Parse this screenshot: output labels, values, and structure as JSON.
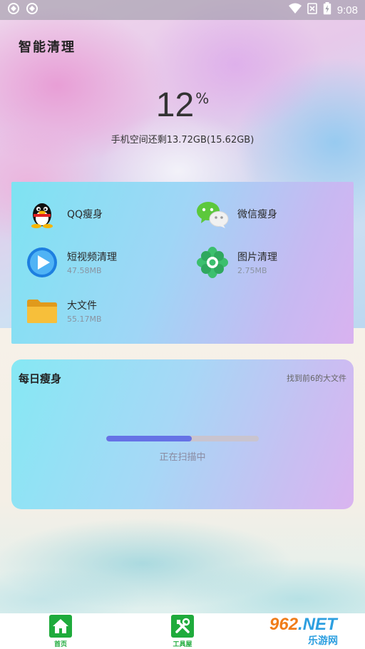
{
  "status_bar": {
    "time": "9:08",
    "left_icons": [
      "settings-shortcut-icon",
      "settings-shortcut-icon"
    ],
    "right_icons": [
      "wifi-icon",
      "no-sim-icon",
      "battery-icon"
    ]
  },
  "header": {
    "title": "智能清理",
    "percent_value": "12",
    "percent_sign": "%",
    "storage_text": "手机空间还剩13.72GB(15.62GB)"
  },
  "features": [
    {
      "name": "QQ瘦身",
      "size": "",
      "icon": "qq-penguin-icon"
    },
    {
      "name": "微信瘦身",
      "size": "",
      "icon": "wechat-icon"
    },
    {
      "name": "短视频清理",
      "size": "47.58MB",
      "icon": "play-video-icon"
    },
    {
      "name": "图片清理",
      "size": "2.75MB",
      "icon": "flower-photo-icon"
    },
    {
      "name": "大文件",
      "size": "55.17MB",
      "icon": "folder-icon"
    }
  ],
  "daily": {
    "title": "每日瘦身",
    "hint": "找到前6的大文件",
    "progress_fraction": 0.56,
    "scan_text": "正在扫描中"
  },
  "bottom_nav": {
    "items": [
      {
        "label": "首页",
        "icon": "home-icon"
      },
      {
        "label": "工具屋",
        "icon": "tools-icon"
      }
    ]
  },
  "watermark": {
    "brand": "962",
    "domain": ".NET",
    "site_name": "乐游网"
  },
  "colors": {
    "accent_green": "#1fab3c",
    "progress_fill": "#6672e6",
    "watermark_orange": "#f07c1a",
    "watermark_blue": "#2d9fe0"
  }
}
